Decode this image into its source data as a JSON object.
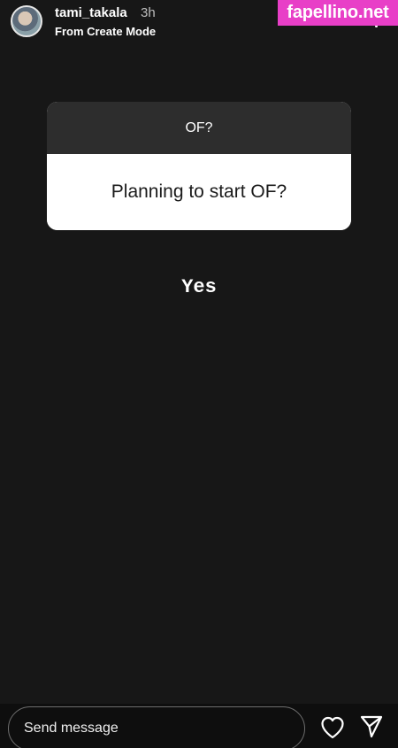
{
  "header": {
    "username": "tami_takala",
    "time": "3h",
    "subtitle": "From Create Mode",
    "avatar_icon": "avatar-photo",
    "more_icon": "more-dots-icon"
  },
  "watermark": {
    "text": "fapellino.net",
    "color": "#e83fc7"
  },
  "question": {
    "title": "OF?",
    "text": "Planning to start OF?"
  },
  "answer": "Yes",
  "footer": {
    "message_placeholder": "Send message",
    "heart_icon": "heart-icon",
    "send_icon": "send-icon"
  }
}
